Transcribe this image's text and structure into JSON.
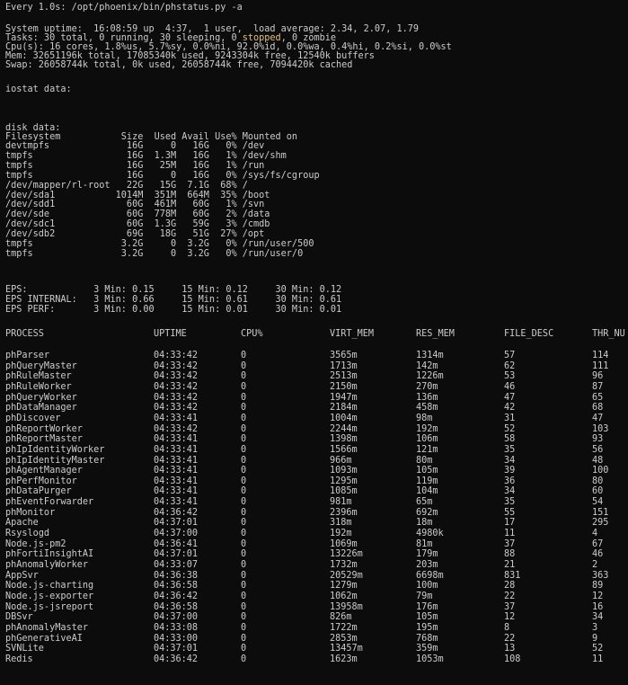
{
  "watch": {
    "header": "Every 1.0s: /opt/phoenix/bin/phstatus.py -a"
  },
  "system": {
    "uptime_line": "System uptime:  16:08:59 up  4:37,  1 user,  load average: 2.34, 2.07, 1.79",
    "tasks_prefix": "Tasks: 30 total, 0 running, 30 sleeping, 0 ",
    "tasks_stopped": "stopped",
    "tasks_suffix": ", 0 zombie",
    "cpu_line": "Cpu(s): 16 cores, 1.8%us, 5.7%sy, 0.0%ni, 92.0%id, 0.0%wa, 0.4%hi, 0.2%si, 0.0%st",
    "mem_line": "Mem: 32651196k total, 17085340k used, 9243304k free, 12540k buffers",
    "swap_line": "Swap: 26058744k total, 0k used, 26058744k free, 7094420k cached"
  },
  "iostat": {
    "label": "iostat data:"
  },
  "disk": {
    "label": "disk data:",
    "header": "Filesystem           Size  Used Avail Use% Mounted on",
    "rows": [
      "devtmpfs              16G     0   16G   0% /dev",
      "tmpfs                 16G  1.3M   16G   1% /dev/shm",
      "tmpfs                 16G   25M   16G   1% /run",
      "tmpfs                 16G     0   16G   0% /sys/fs/cgroup",
      "/dev/mapper/rl-root   22G   15G  7.1G  68% /",
      "/dev/sda1           1014M  351M  664M  35% /boot",
      "/dev/sdd1             60G  461M   60G   1% /svn",
      "/dev/sde              60G  778M   60G   2% /data",
      "/dev/sdc1             60G  1.3G   59G   3% /cmdb",
      "/dev/sdb2             69G   18G   51G  27% /opt",
      "tmpfs                3.2G     0  3.2G   0% /run/user/500",
      "tmpfs                3.2G     0  3.2G   0% /run/user/0"
    ]
  },
  "eps": {
    "rows": [
      "EPS:            3 Min: 0.15     15 Min: 0.12     30 Min: 0.12",
      "EPS INTERNAL:   3 Min: 0.66     15 Min: 0.61     30 Min: 0.61",
      "EPS PERF:       3 Min: 0.00     15 Min: 0.01     30 Min: 0.01"
    ]
  },
  "processes": {
    "columns": [
      "PROCESS",
      "UPTIME",
      "CPU%",
      "VIRT_MEM",
      "RES_MEM",
      "FILE_DESC",
      "THR_NU"
    ],
    "rows": [
      [
        "phParser",
        "04:33:42",
        "0",
        "3565m",
        "1314m",
        "57",
        "114"
      ],
      [
        "phQueryMaster",
        "04:33:42",
        "0",
        "1713m",
        "142m",
        "62",
        "111"
      ],
      [
        "phRuleMaster",
        "04:33:42",
        "0",
        "2513m",
        "1226m",
        "53",
        "96"
      ],
      [
        "phRuleWorker",
        "04:33:42",
        "0",
        "2150m",
        "270m",
        "46",
        "87"
      ],
      [
        "phQueryWorker",
        "04:33:42",
        "0",
        "1947m",
        "136m",
        "47",
        "65"
      ],
      [
        "phDataManager",
        "04:33:42",
        "0",
        "2184m",
        "458m",
        "42",
        "68"
      ],
      [
        "phDiscover",
        "04:33:41",
        "0",
        "1004m",
        "98m",
        "31",
        "47"
      ],
      [
        "phReportWorker",
        "04:33:42",
        "0",
        "2244m",
        "192m",
        "52",
        "103"
      ],
      [
        "phReportMaster",
        "04:33:41",
        "0",
        "1398m",
        "106m",
        "58",
        "93"
      ],
      [
        "phIpIdentityWorker",
        "04:33:41",
        "0",
        "1566m",
        "121m",
        "35",
        "56"
      ],
      [
        "phIpIdentityMaster",
        "04:33:41",
        "0",
        "966m",
        "80m",
        "34",
        "48"
      ],
      [
        "phAgentManager",
        "04:33:41",
        "0",
        "1093m",
        "105m",
        "39",
        "100"
      ],
      [
        "phPerfMonitor",
        "04:33:41",
        "0",
        "1295m",
        "119m",
        "36",
        "80"
      ],
      [
        "phDataPurger",
        "04:33:41",
        "0",
        "1085m",
        "104m",
        "34",
        "60"
      ],
      [
        "phEventForwarder",
        "04:33:41",
        "0",
        "981m",
        "65m",
        "35",
        "54"
      ],
      [
        "phMonitor",
        "04:36:42",
        "0",
        "2396m",
        "692m",
        "55",
        "151"
      ],
      [
        "Apache",
        "04:37:01",
        "0",
        "318m",
        "18m",
        "17",
        "295"
      ],
      [
        "Rsyslogd",
        "04:37:00",
        "0",
        "192m",
        "4980k",
        "11",
        "4"
      ],
      [
        "Node.js-pm2",
        "04:36:41",
        "0",
        "1069m",
        "81m",
        "37",
        "67"
      ],
      [
        "phFortiInsightAI",
        "04:37:01",
        "0",
        "13226m",
        "179m",
        "88",
        "46"
      ],
      [
        "phAnomalyWorker",
        "04:33:07",
        "0",
        "1732m",
        "203m",
        "21",
        "2"
      ],
      [
        "AppSvr",
        "04:36:38",
        "0",
        "20529m",
        "6698m",
        "831",
        "363"
      ],
      [
        "Node.js-charting",
        "04:36:58",
        "0",
        "1279m",
        "100m",
        "28",
        "89"
      ],
      [
        "Node.js-exporter",
        "04:36:42",
        "0",
        "1062m",
        "79m",
        "22",
        "12"
      ],
      [
        "Node.js-jsreport",
        "04:36:58",
        "0",
        "13958m",
        "176m",
        "37",
        "16"
      ],
      [
        "DBSvr",
        "04:37:00",
        "0",
        "826m",
        "105m",
        "12",
        "34"
      ],
      [
        "phAnomalyMaster",
        "04:33:08",
        "0",
        "1722m",
        "195m",
        "8",
        "3"
      ],
      [
        "phGenerativeAI",
        "04:33:00",
        "0",
        "2853m",
        "768m",
        "22",
        "9"
      ],
      [
        "SVNLite",
        "04:37:01",
        "0",
        "13457m",
        "359m",
        "13",
        "52"
      ],
      [
        "Redis",
        "04:36:42",
        "0",
        "1623m",
        "1053m",
        "108",
        "11"
      ]
    ]
  }
}
